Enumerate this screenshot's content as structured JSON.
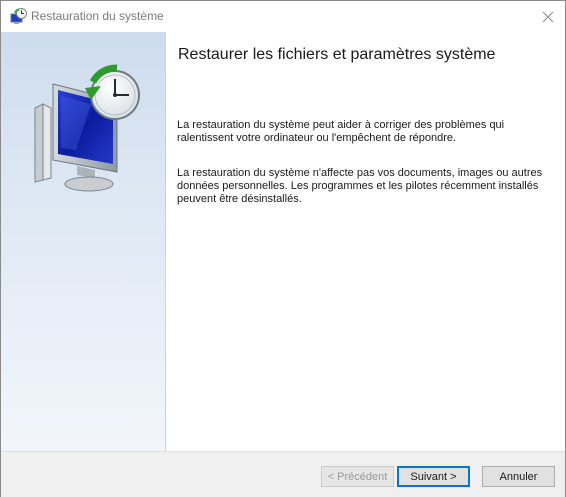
{
  "window": {
    "title": "Restauration du système"
  },
  "content": {
    "heading": "Restaurer les fichiers et paramètres système",
    "paragraph1": "La restauration du système peut aider à corriger des problèmes qui ralentissent votre ordinateur ou l'empêchent de répondre.",
    "paragraph2": "La restauration du système n'affecte pas vos documents, images ou autres données personnelles. Les programmes et les pilotes récemment installés peuvent être désinstallés."
  },
  "footer": {
    "prev_label": "< Précédent",
    "next_label": "Suivant >",
    "cancel_label": "Annuler"
  },
  "icons": {
    "title": "system-restore-icon",
    "close": "close-icon",
    "sidebar": "system-restore-illustration"
  },
  "colors": {
    "accent": "#0078d7",
    "sidebar_top": "#cddcee",
    "sidebar_bottom": "#f2f6fb",
    "disabled_text": "#9a9a9a"
  }
}
